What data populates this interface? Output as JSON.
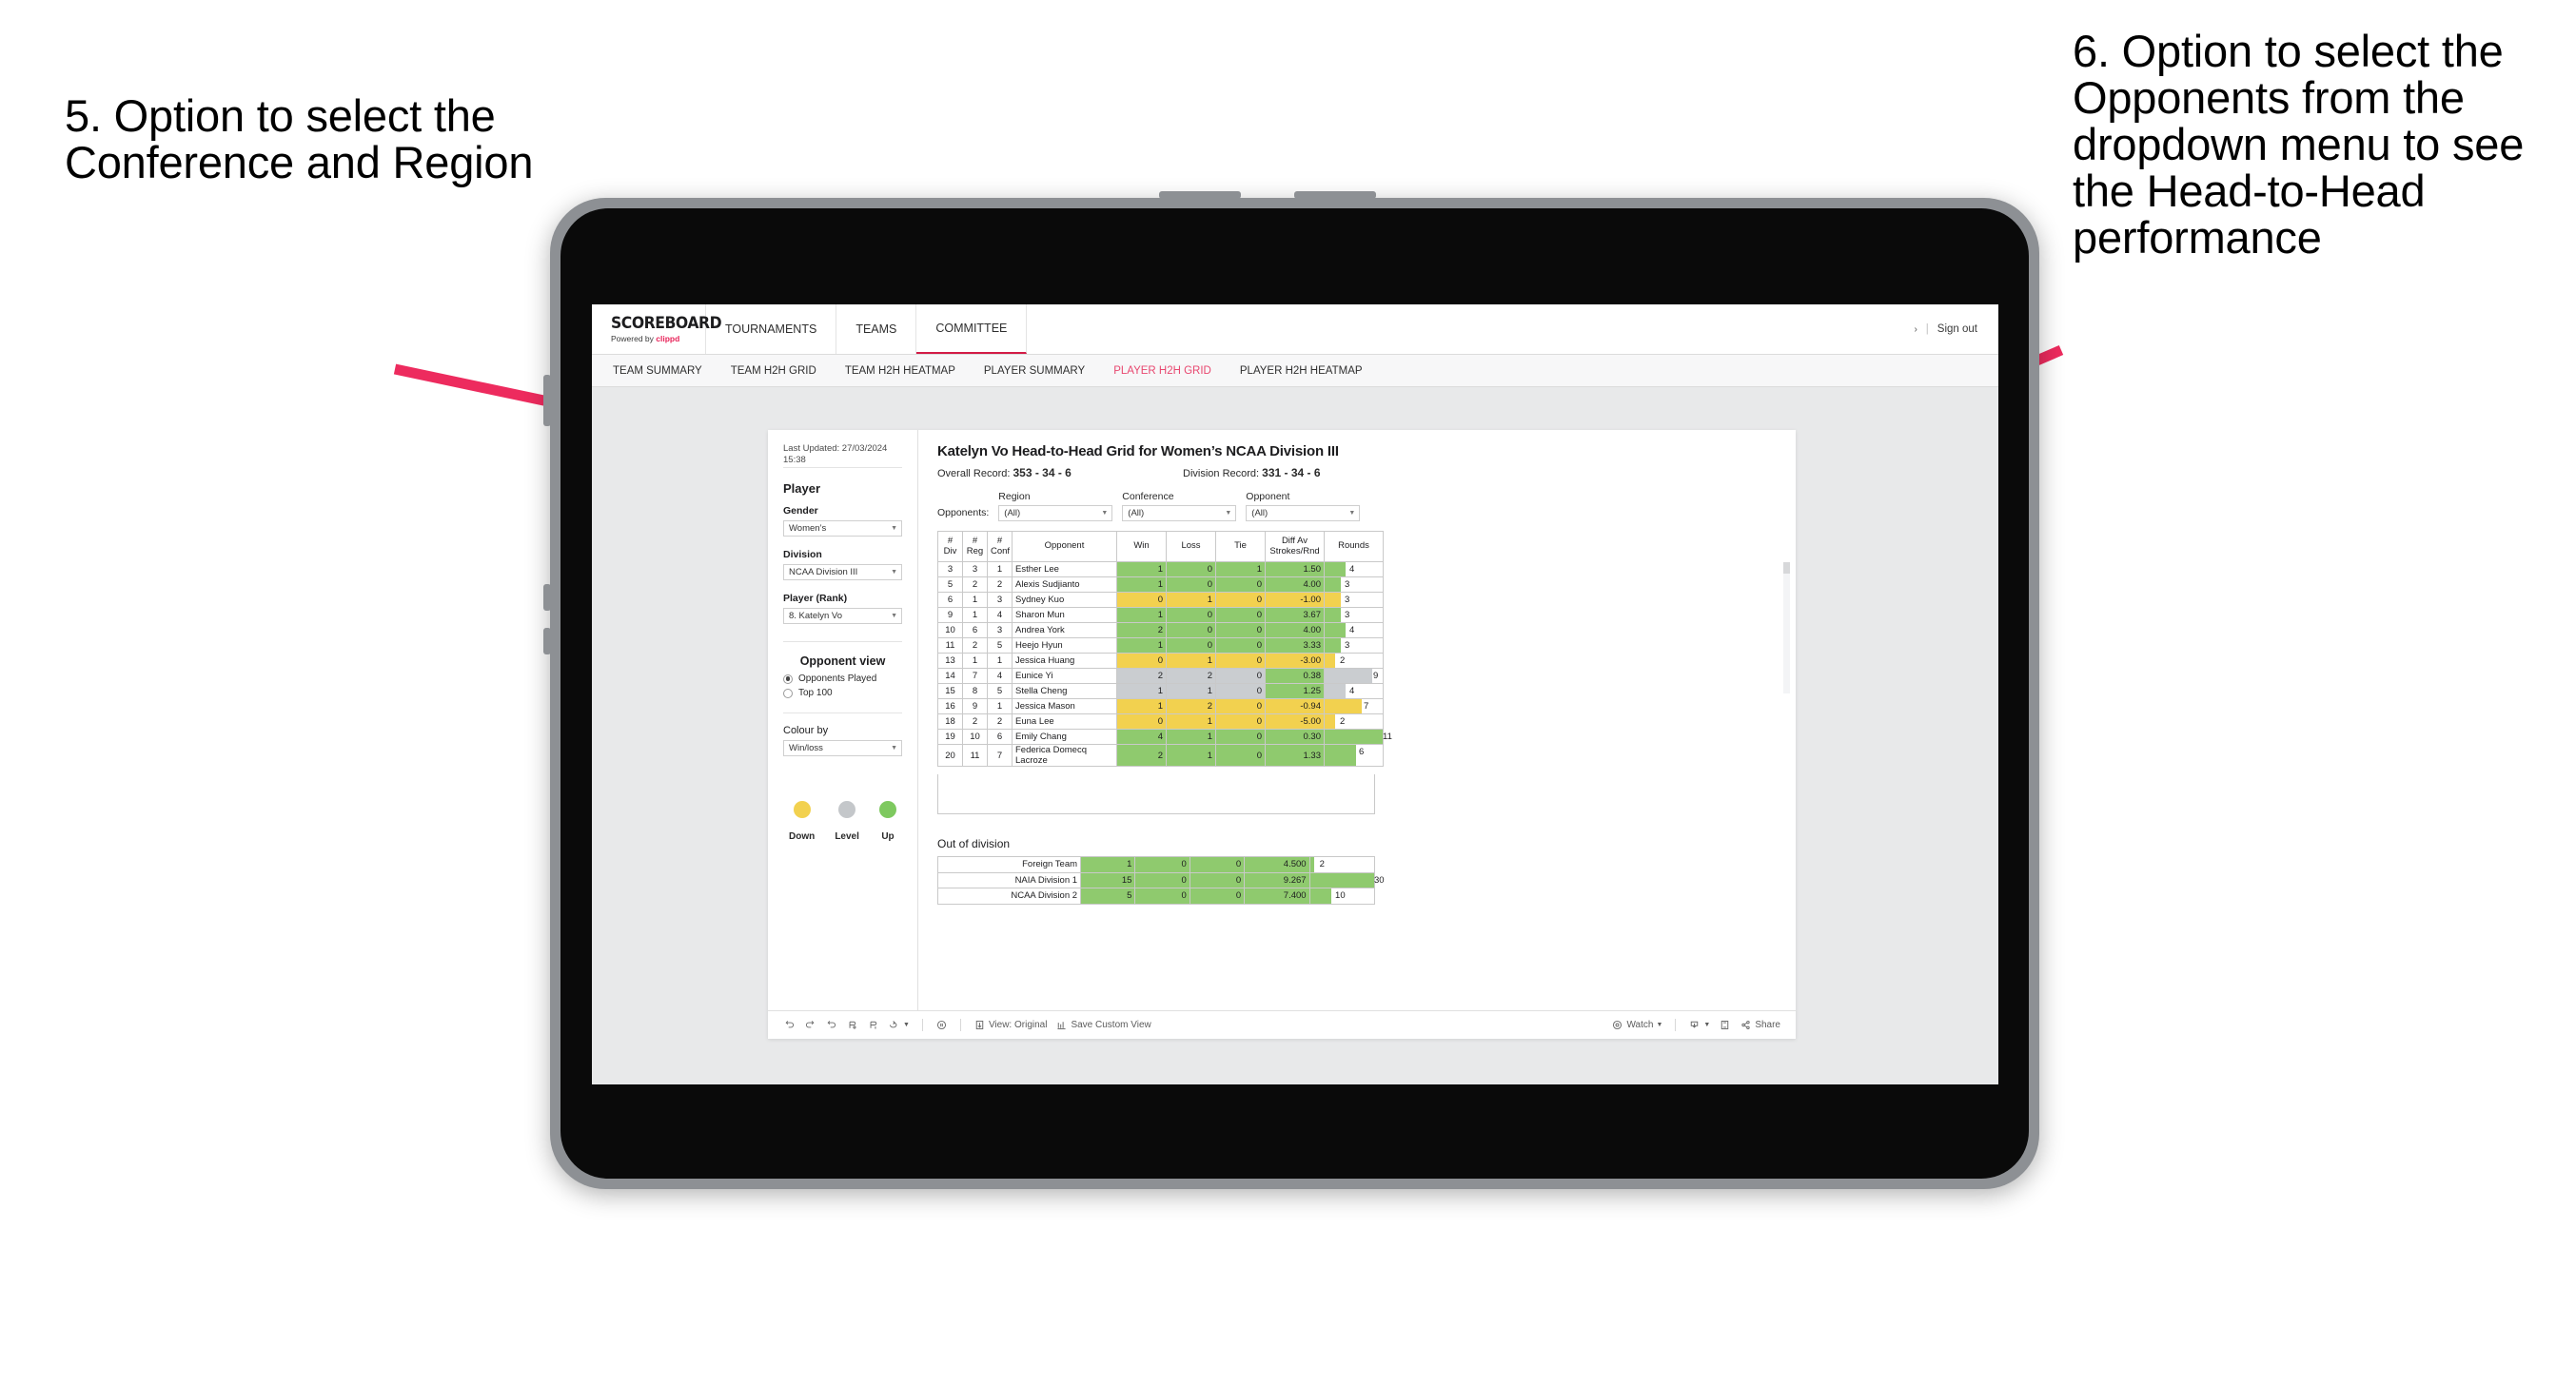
{
  "annotations": {
    "left": "5. Option to select the Conference and Region",
    "right": "6. Option to select the Opponents from the dropdown menu to see the Head-to-Head performance",
    "arrow_color": "#ed2b5e"
  },
  "topnav": {
    "logo_main": "SCOREBOARD",
    "logo_sub_prefix": "Powered by ",
    "logo_brand": "clippd",
    "items": [
      {
        "label": "TOURNAMENTS",
        "active": false
      },
      {
        "label": "TEAMS",
        "active": false
      },
      {
        "label": "COMMITTEE",
        "active": true
      }
    ],
    "chevron": "›",
    "separator": "|",
    "sign_out": "Sign out",
    "active_underline_color": "#d21b46"
  },
  "subnav": {
    "items": [
      {
        "label": "TEAM SUMMARY",
        "active": false
      },
      {
        "label": "TEAM H2H GRID",
        "active": false
      },
      {
        "label": "TEAM H2H HEATMAP",
        "active": false
      },
      {
        "label": "PLAYER SUMMARY",
        "active": false
      },
      {
        "label": "PLAYER H2H GRID",
        "active": true
      },
      {
        "label": "PLAYER H2H HEATMAP",
        "active": false
      }
    ],
    "active_color": "#e8476f"
  },
  "sidebar": {
    "last_updated": "Last Updated: 27/03/2024 15:38",
    "heading": "Player",
    "fields": [
      {
        "label": "Gender",
        "value": "Women’s"
      },
      {
        "label": "Division",
        "value": "NCAA Division III"
      },
      {
        "label": "Player (Rank)",
        "value": "8. Katelyn Vo"
      }
    ],
    "opponent_view": {
      "heading": "Opponent view",
      "options": [
        {
          "label": "Opponents Played",
          "selected": true
        },
        {
          "label": "Top 100",
          "selected": false
        }
      ]
    },
    "colour_by": {
      "label": "Colour by",
      "value": "Win/loss"
    },
    "legend": [
      {
        "label": "Down",
        "color": "#f2d14f"
      },
      {
        "label": "Level",
        "color": "#c4c7ca"
      },
      {
        "label": "Up",
        "color": "#7ec95f"
      }
    ]
  },
  "main": {
    "title": "Katelyn Vo Head-to-Head Grid for Women’s NCAA Division III",
    "overall_record_label": "Overall Record: ",
    "overall_record_value": "353 - 34 - 6",
    "division_record_label": "Division Record: ",
    "division_record_value": "331 - 34 - 6",
    "opponents_label": "Opponents:",
    "filters": [
      {
        "label": "Region",
        "value": "(All)"
      },
      {
        "label": "Conference",
        "value": "(All)"
      },
      {
        "label": "Opponent",
        "value": "(All)"
      }
    ]
  },
  "chart_data": {
    "type": "table",
    "title": "Katelyn Vo Head-to-Head Grid for Women’s NCAA Division III",
    "columns": [
      "# Div",
      "# Reg",
      "# Conf",
      "Opponent",
      "Win",
      "Loss",
      "Tie",
      "Diff Av Strokes/Rnd",
      "Rounds"
    ],
    "rounds_max": 11,
    "rows": [
      {
        "div": "3",
        "reg": "3",
        "conf": "1",
        "opponent": "Esther Lee",
        "win": "1",
        "loss": "0",
        "tie": "1",
        "diff": "1.50",
        "rounds": "4",
        "status": "up",
        "diff_status": "up"
      },
      {
        "div": "5",
        "reg": "2",
        "conf": "2",
        "opponent": "Alexis Sudjianto",
        "win": "1",
        "loss": "0",
        "tie": "0",
        "diff": "4.00",
        "rounds": "3",
        "status": "up",
        "diff_status": "up"
      },
      {
        "div": "6",
        "reg": "1",
        "conf": "3",
        "opponent": "Sydney Kuo",
        "win": "0",
        "loss": "1",
        "tie": "0",
        "diff": "-1.00",
        "rounds": "3",
        "status": "down",
        "diff_status": "down"
      },
      {
        "div": "9",
        "reg": "1",
        "conf": "4",
        "opponent": "Sharon Mun",
        "win": "1",
        "loss": "0",
        "tie": "0",
        "diff": "3.67",
        "rounds": "3",
        "status": "up",
        "diff_status": "up"
      },
      {
        "div": "10",
        "reg": "6",
        "conf": "3",
        "opponent": "Andrea York",
        "win": "2",
        "loss": "0",
        "tie": "0",
        "diff": "4.00",
        "rounds": "4",
        "status": "up",
        "diff_status": "up"
      },
      {
        "div": "11",
        "reg": "2",
        "conf": "5",
        "opponent": "Heejo Hyun",
        "win": "1",
        "loss": "0",
        "tie": "0",
        "diff": "3.33",
        "rounds": "3",
        "status": "up",
        "diff_status": "up"
      },
      {
        "div": "13",
        "reg": "1",
        "conf": "1",
        "opponent": "Jessica Huang",
        "win": "0",
        "loss": "1",
        "tie": "0",
        "diff": "-3.00",
        "rounds": "2",
        "status": "down",
        "diff_status": "down"
      },
      {
        "div": "14",
        "reg": "7",
        "conf": "4",
        "opponent": "Eunice Yi",
        "win": "2",
        "loss": "2",
        "tie": "0",
        "diff": "0.38",
        "rounds": "9",
        "status": "level",
        "diff_status": "up"
      },
      {
        "div": "15",
        "reg": "8",
        "conf": "5",
        "opponent": "Stella Cheng",
        "win": "1",
        "loss": "1",
        "tie": "0",
        "diff": "1.25",
        "rounds": "4",
        "status": "level",
        "diff_status": "up"
      },
      {
        "div": "16",
        "reg": "9",
        "conf": "1",
        "opponent": "Jessica Mason",
        "win": "1",
        "loss": "2",
        "tie": "0",
        "diff": "-0.94",
        "rounds": "7",
        "status": "down",
        "diff_status": "down"
      },
      {
        "div": "18",
        "reg": "2",
        "conf": "2",
        "opponent": "Euna Lee",
        "win": "0",
        "loss": "1",
        "tie": "0",
        "diff": "-5.00",
        "rounds": "2",
        "status": "down",
        "diff_status": "down"
      },
      {
        "div": "19",
        "reg": "10",
        "conf": "6",
        "opponent": "Emily Chang",
        "win": "4",
        "loss": "1",
        "tie": "0",
        "diff": "0.30",
        "rounds": "11",
        "status": "up",
        "diff_status": "up"
      },
      {
        "div": "20",
        "reg": "11",
        "conf": "7",
        "opponent": "Federica Domecq Lacroze",
        "win": "2",
        "loss": "1",
        "tie": "0",
        "diff": "1.33",
        "rounds": "6",
        "status": "up",
        "diff_status": "up"
      }
    ]
  },
  "out_of_division": {
    "title": "Out of division",
    "rounds_max": 30,
    "rows": [
      {
        "name": "Foreign Team",
        "win": "1",
        "loss": "0",
        "tie": "0",
        "diff": "4.500",
        "rounds": "2",
        "status": "up"
      },
      {
        "name": "NAIA Division 1",
        "win": "15",
        "loss": "0",
        "tie": "0",
        "diff": "9.267",
        "rounds": "30",
        "status": "up"
      },
      {
        "name": "NCAA Division 2",
        "win": "5",
        "loss": "0",
        "tie": "0",
        "diff": "7.400",
        "rounds": "10",
        "status": "up"
      }
    ]
  },
  "toolbar": {
    "view_label": "View: Original",
    "save_label": "Save Custom View",
    "watch_label": "Watch",
    "share_label": "Share"
  }
}
